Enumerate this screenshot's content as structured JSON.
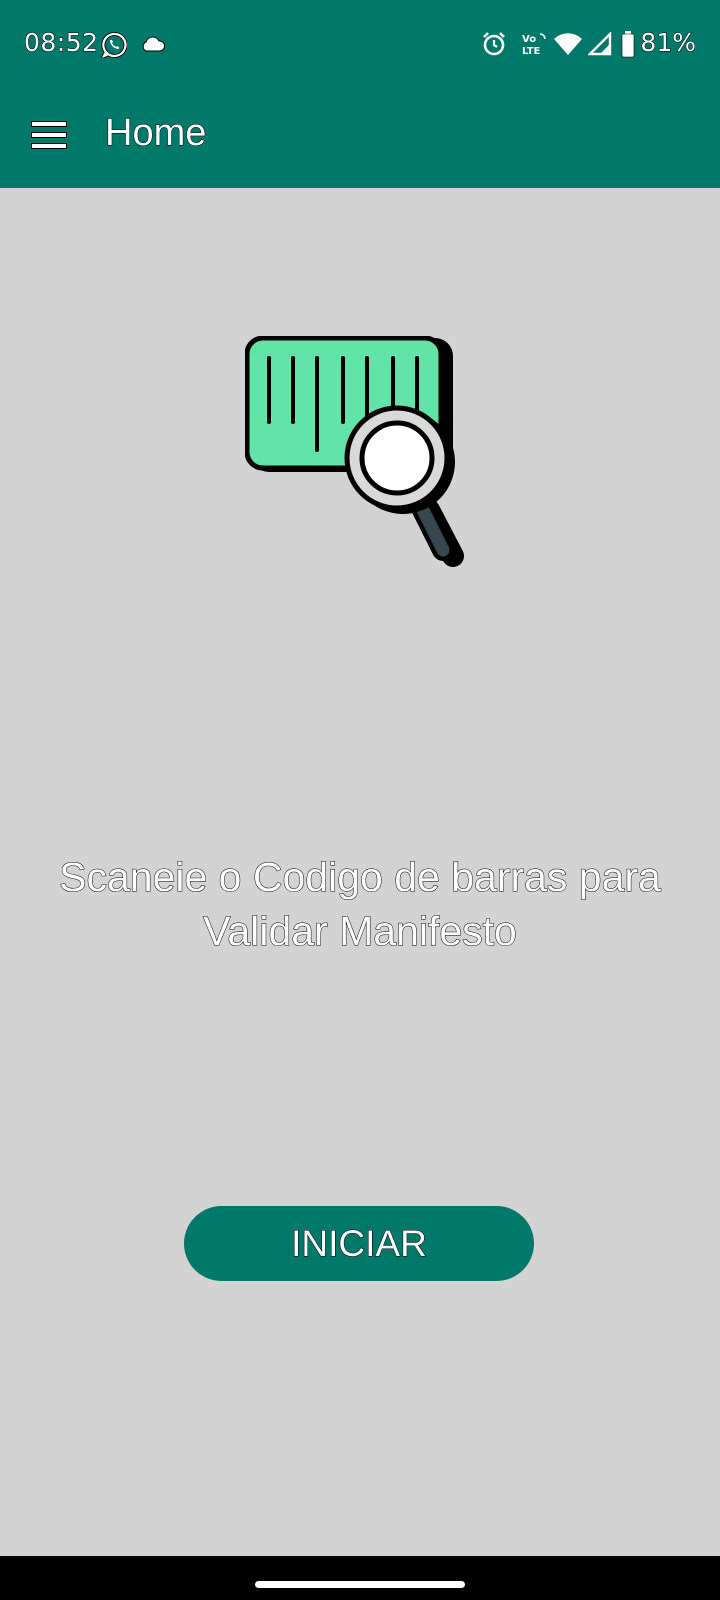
{
  "status_bar": {
    "time": "08:52",
    "battery": "81%",
    "icons": [
      "whatsapp-icon",
      "cloud-icon",
      "alarm-icon",
      "volte-icon",
      "wifi-icon",
      "signal-icon",
      "battery-icon"
    ]
  },
  "app_bar": {
    "title": "Home",
    "menu_icon": "hamburger-menu-icon"
  },
  "main": {
    "illustration": "barcode-search-icon",
    "instruction_line1": "Scaneie o Codigo de barras para",
    "instruction_line2": "Validar Manifesto",
    "start_button": "INICIAR"
  },
  "colors": {
    "primary": "#00796b",
    "background": "#d3d3d3",
    "barcode_fill": "#62e3a7",
    "magnifier_handle": "#37474f"
  }
}
